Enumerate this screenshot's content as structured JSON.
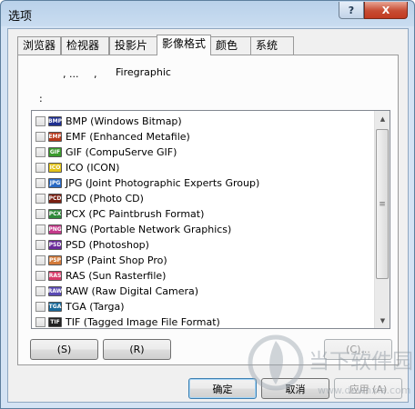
{
  "window": {
    "title": "选项",
    "help_label": "?",
    "close_label": "X"
  },
  "tabs": [
    {
      "label": "浏览器",
      "active": false
    },
    {
      "label": "检视器",
      "active": false
    },
    {
      "label": "投影片",
      "active": false
    },
    {
      "label": "影像格式",
      "active": true
    },
    {
      "label": "颜色",
      "active": false
    },
    {
      "label": "系统",
      "active": false
    }
  ],
  "panel": {
    "desc_part1": ", ...",
    "desc_part2": ",",
    "desc_app": "Firegraphic",
    "list_label": ":"
  },
  "formats": [
    {
      "label": "BMP (Windows Bitmap)",
      "icon": "bmp-icon",
      "icon_text": "BMP",
      "color": "#1f2f8f",
      "checked": false
    },
    {
      "label": "EMF (Enhanced Metafile)",
      "icon": "emf-icon",
      "icon_text": "EMF",
      "color": "#b9381a",
      "checked": false
    },
    {
      "label": "GIF (CompuServe GIF)",
      "icon": "gif-icon",
      "icon_text": "GIF",
      "color": "#3a9a2c",
      "checked": false
    },
    {
      "label": "ICO (ICON)",
      "icon": "ico-icon",
      "icon_text": "ICO",
      "color": "#e2c21a",
      "checked": false
    },
    {
      "label": "JPG (Joint Photographic Experts Group)",
      "icon": "jpg-icon",
      "icon_text": "JPG",
      "color": "#2a6ac4",
      "checked": false
    },
    {
      "label": "PCD (Photo CD)",
      "icon": "pcd-icon",
      "icon_text": "PCD",
      "color": "#7a1f12",
      "checked": false
    },
    {
      "label": "PCX (PC Paintbrush Format)",
      "icon": "pcx-icon",
      "icon_text": "PCX",
      "color": "#2f8a3a",
      "checked": false
    },
    {
      "label": "PNG (Portable Network Graphics)",
      "icon": "png-icon",
      "icon_text": "PNG",
      "color": "#c43a8a",
      "checked": false
    },
    {
      "label": "PSD (Photoshop)",
      "icon": "psd-icon",
      "icon_text": "PSD",
      "color": "#6a2a9a",
      "checked": false
    },
    {
      "label": "PSP (Paint Shop Pro)",
      "icon": "psp-icon",
      "icon_text": "PSP",
      "color": "#d27a3a",
      "checked": false
    },
    {
      "label": "RAS (Sun Rasterfile)",
      "icon": "ras-icon",
      "icon_text": "RAS",
      "color": "#d83a6a",
      "checked": false
    },
    {
      "label": "RAW (Raw Digital Camera)",
      "icon": "raw-icon",
      "icon_text": "RAW",
      "color": "#5a4ab4",
      "checked": false
    },
    {
      "label": "TGA (Targa)",
      "icon": "tga-icon",
      "icon_text": "TGA",
      "color": "#1a6a9a",
      "checked": false
    },
    {
      "label": "TIF (Tagged Image File Format)",
      "icon": "tif-icon",
      "icon_text": "TIF",
      "color": "#222222",
      "checked": false
    }
  ],
  "panel_buttons": {
    "select_all": "(S)",
    "reverse": "(R)",
    "custom": "(C)..."
  },
  "footer_buttons": {
    "ok": "确定",
    "cancel": "取消",
    "apply": "应用 (A)"
  },
  "watermark": {
    "text": "当下软件园",
    "url": "www.downxia.com"
  }
}
